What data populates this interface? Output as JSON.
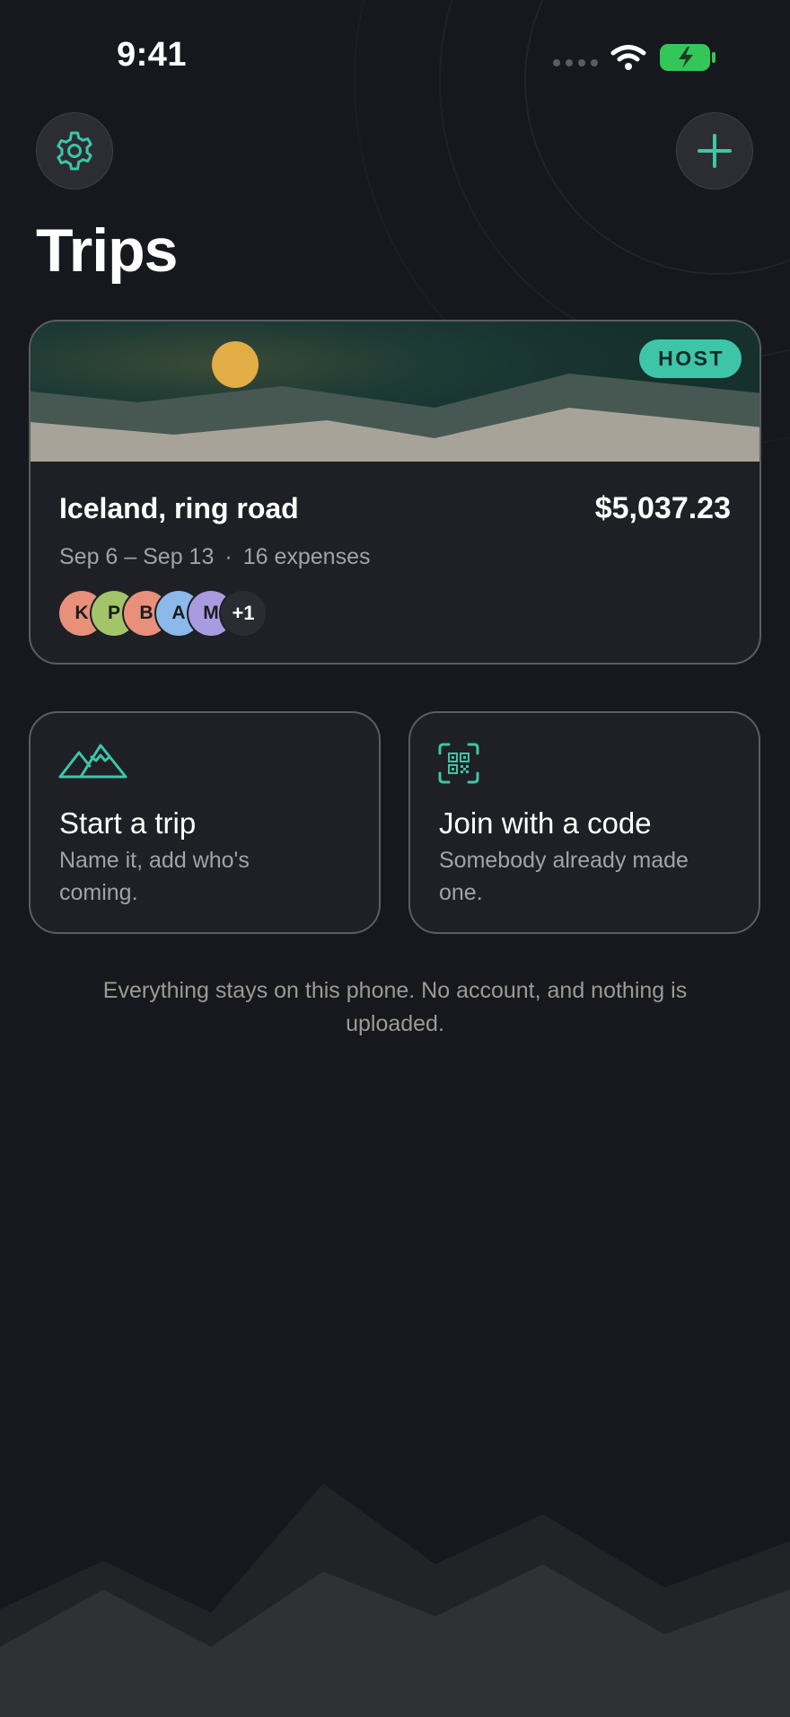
{
  "status_bar": {
    "time": "9:41"
  },
  "header": {
    "title": "Trips",
    "settings_icon": "gear-icon",
    "add_icon": "plus-icon"
  },
  "trip": {
    "badge": "HOST",
    "name": "Iceland, ring road",
    "total": "$5,037.23",
    "dates": "Sep 6 – Sep 13",
    "separator": "·",
    "expenses": "16 expenses",
    "participants": [
      {
        "initial": "K",
        "color": "#e8907a"
      },
      {
        "initial": "P",
        "color": "#a3c46a"
      },
      {
        "initial": "B",
        "color": "#e8907a"
      },
      {
        "initial": "A",
        "color": "#8cb8ea"
      },
      {
        "initial": "M",
        "color": "#a99be0"
      }
    ],
    "more_participants": "+1"
  },
  "actions": {
    "start": {
      "icon": "mountains-icon",
      "title": "Start a trip",
      "description": "Name it, add who's coming."
    },
    "join": {
      "icon": "qr-code-icon",
      "title": "Join with a code",
      "description": "Somebody already made one."
    }
  },
  "footer_note": "Everything stays on this phone. No account, and nothing is uploaded.",
  "colors": {
    "accent": "#3ec5a8",
    "background": "#16181d",
    "card": "#1e2025",
    "sun": "#e2ad45"
  }
}
